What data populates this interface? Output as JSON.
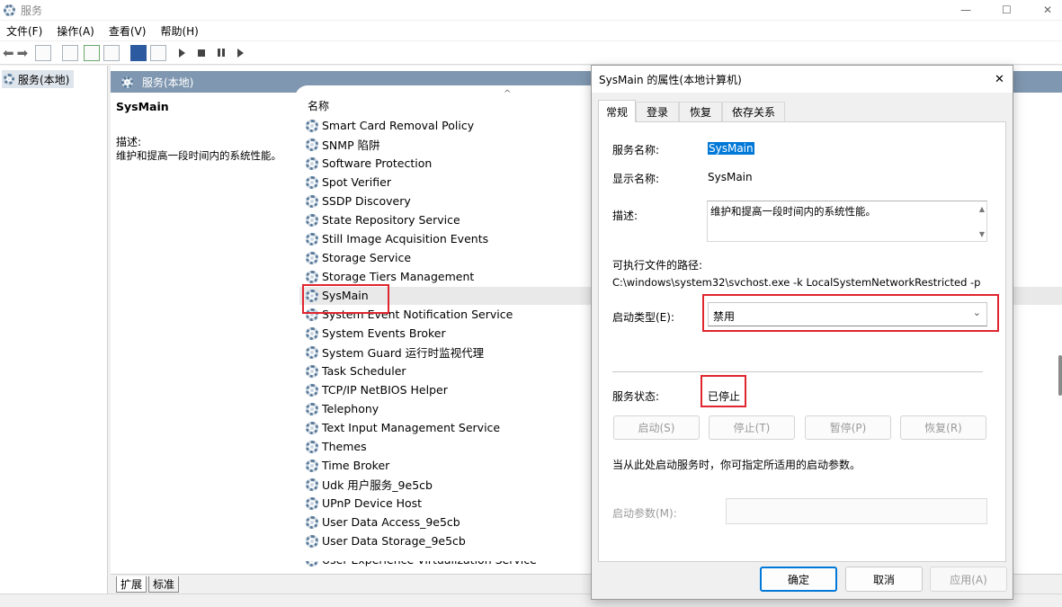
{
  "window": {
    "title": "服务",
    "min": "—",
    "max": "☐",
    "close": "✕"
  },
  "menu": [
    "文件(F)",
    "操作(A)",
    "查看(V)",
    "帮助(H)"
  ],
  "tree": {
    "root": "服务(本地)"
  },
  "panel": {
    "header": "服务(本地)",
    "name": "SysMain",
    "desc_label": "描述:",
    "desc": "维护和提高一段时间内的系统性能。",
    "col_name": "名称"
  },
  "services": [
    "Smart Card Removal Policy",
    "SNMP 陷阱",
    "Software Protection",
    "Spot Verifier",
    "SSDP Discovery",
    "State Repository Service",
    "Still Image Acquisition Events",
    "Storage Service",
    "Storage Tiers Management",
    "SysMain",
    "System Event Notification Service",
    "System Events Broker",
    "System Guard 运行时监视代理",
    "Task Scheduler",
    "TCP/IP NetBIOS Helper",
    "Telephony",
    "Text Input Management Service",
    "Themes",
    "Time Broker",
    "Udk 用户服务_9e5cb",
    "UPnP Device Host",
    "User Data Access_9e5cb",
    "User Data Storage_9e5cb",
    "User Experience Virtualization Service"
  ],
  "bottom_tabs": [
    "扩展",
    "标准"
  ],
  "dialog": {
    "title": "SysMain 的属性(本地计算机)",
    "close": "✕",
    "tabs": [
      "常规",
      "登录",
      "恢复",
      "依存关系"
    ],
    "service_name_label": "服务名称:",
    "service_name": "SysMain",
    "display_name_label": "显示名称:",
    "display_name": "SysMain",
    "desc_label": "描述:",
    "desc": "维护和提高一段时间内的系统性能。",
    "path_label": "可执行文件的路径:",
    "path": "C:\\windows\\system32\\svchost.exe -k LocalSystemNetworkRestricted -p",
    "startup_label": "启动类型(E):",
    "startup_value": "禁用",
    "status_label": "服务状态:",
    "status_value": "已停止",
    "btn_start": "启动(S)",
    "btn_stop": "停止(T)",
    "btn_pause": "暂停(P)",
    "btn_resume": "恢复(R)",
    "hint": "当从此处启动服务时，你可指定所适用的启动参数。",
    "param_label": "启动参数(M):",
    "param_value": "",
    "ok": "确定",
    "cancel": "取消",
    "apply": "应用(A)"
  },
  "colors": {
    "accent": "#0078d7",
    "highlight_box": "#e0252e",
    "panel_header": "#7f97b0"
  }
}
